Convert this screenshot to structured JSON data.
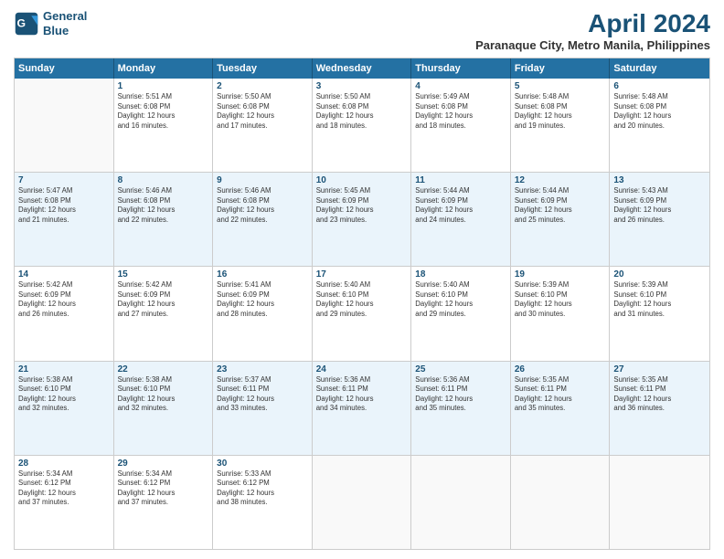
{
  "logo": {
    "line1": "General",
    "line2": "Blue"
  },
  "title": "April 2024",
  "subtitle": "Paranaque City, Metro Manila, Philippines",
  "days_header": [
    "Sunday",
    "Monday",
    "Tuesday",
    "Wednesday",
    "Thursday",
    "Friday",
    "Saturday"
  ],
  "weeks": [
    [
      {
        "day": "",
        "info": ""
      },
      {
        "day": "1",
        "info": "Sunrise: 5:51 AM\nSunset: 6:08 PM\nDaylight: 12 hours\nand 16 minutes."
      },
      {
        "day": "2",
        "info": "Sunrise: 5:50 AM\nSunset: 6:08 PM\nDaylight: 12 hours\nand 17 minutes."
      },
      {
        "day": "3",
        "info": "Sunrise: 5:50 AM\nSunset: 6:08 PM\nDaylight: 12 hours\nand 18 minutes."
      },
      {
        "day": "4",
        "info": "Sunrise: 5:49 AM\nSunset: 6:08 PM\nDaylight: 12 hours\nand 18 minutes."
      },
      {
        "day": "5",
        "info": "Sunrise: 5:48 AM\nSunset: 6:08 PM\nDaylight: 12 hours\nand 19 minutes."
      },
      {
        "day": "6",
        "info": "Sunrise: 5:48 AM\nSunset: 6:08 PM\nDaylight: 12 hours\nand 20 minutes."
      }
    ],
    [
      {
        "day": "7",
        "info": "Sunrise: 5:47 AM\nSunset: 6:08 PM\nDaylight: 12 hours\nand 21 minutes."
      },
      {
        "day": "8",
        "info": "Sunrise: 5:46 AM\nSunset: 6:08 PM\nDaylight: 12 hours\nand 22 minutes."
      },
      {
        "day": "9",
        "info": "Sunrise: 5:46 AM\nSunset: 6:08 PM\nDaylight: 12 hours\nand 22 minutes."
      },
      {
        "day": "10",
        "info": "Sunrise: 5:45 AM\nSunset: 6:09 PM\nDaylight: 12 hours\nand 23 minutes."
      },
      {
        "day": "11",
        "info": "Sunrise: 5:44 AM\nSunset: 6:09 PM\nDaylight: 12 hours\nand 24 minutes."
      },
      {
        "day": "12",
        "info": "Sunrise: 5:44 AM\nSunset: 6:09 PM\nDaylight: 12 hours\nand 25 minutes."
      },
      {
        "day": "13",
        "info": "Sunrise: 5:43 AM\nSunset: 6:09 PM\nDaylight: 12 hours\nand 26 minutes."
      }
    ],
    [
      {
        "day": "14",
        "info": "Sunrise: 5:42 AM\nSunset: 6:09 PM\nDaylight: 12 hours\nand 26 minutes."
      },
      {
        "day": "15",
        "info": "Sunrise: 5:42 AM\nSunset: 6:09 PM\nDaylight: 12 hours\nand 27 minutes."
      },
      {
        "day": "16",
        "info": "Sunrise: 5:41 AM\nSunset: 6:09 PM\nDaylight: 12 hours\nand 28 minutes."
      },
      {
        "day": "17",
        "info": "Sunrise: 5:40 AM\nSunset: 6:10 PM\nDaylight: 12 hours\nand 29 minutes."
      },
      {
        "day": "18",
        "info": "Sunrise: 5:40 AM\nSunset: 6:10 PM\nDaylight: 12 hours\nand 29 minutes."
      },
      {
        "day": "19",
        "info": "Sunrise: 5:39 AM\nSunset: 6:10 PM\nDaylight: 12 hours\nand 30 minutes."
      },
      {
        "day": "20",
        "info": "Sunrise: 5:39 AM\nSunset: 6:10 PM\nDaylight: 12 hours\nand 31 minutes."
      }
    ],
    [
      {
        "day": "21",
        "info": "Sunrise: 5:38 AM\nSunset: 6:10 PM\nDaylight: 12 hours\nand 32 minutes."
      },
      {
        "day": "22",
        "info": "Sunrise: 5:38 AM\nSunset: 6:10 PM\nDaylight: 12 hours\nand 32 minutes."
      },
      {
        "day": "23",
        "info": "Sunrise: 5:37 AM\nSunset: 6:11 PM\nDaylight: 12 hours\nand 33 minutes."
      },
      {
        "day": "24",
        "info": "Sunrise: 5:36 AM\nSunset: 6:11 PM\nDaylight: 12 hours\nand 34 minutes."
      },
      {
        "day": "25",
        "info": "Sunrise: 5:36 AM\nSunset: 6:11 PM\nDaylight: 12 hours\nand 35 minutes."
      },
      {
        "day": "26",
        "info": "Sunrise: 5:35 AM\nSunset: 6:11 PM\nDaylight: 12 hours\nand 35 minutes."
      },
      {
        "day": "27",
        "info": "Sunrise: 5:35 AM\nSunset: 6:11 PM\nDaylight: 12 hours\nand 36 minutes."
      }
    ],
    [
      {
        "day": "28",
        "info": "Sunrise: 5:34 AM\nSunset: 6:12 PM\nDaylight: 12 hours\nand 37 minutes."
      },
      {
        "day": "29",
        "info": "Sunrise: 5:34 AM\nSunset: 6:12 PM\nDaylight: 12 hours\nand 37 minutes."
      },
      {
        "day": "30",
        "info": "Sunrise: 5:33 AM\nSunset: 6:12 PM\nDaylight: 12 hours\nand 38 minutes."
      },
      {
        "day": "",
        "info": ""
      },
      {
        "day": "",
        "info": ""
      },
      {
        "day": "",
        "info": ""
      },
      {
        "day": "",
        "info": ""
      }
    ]
  ]
}
